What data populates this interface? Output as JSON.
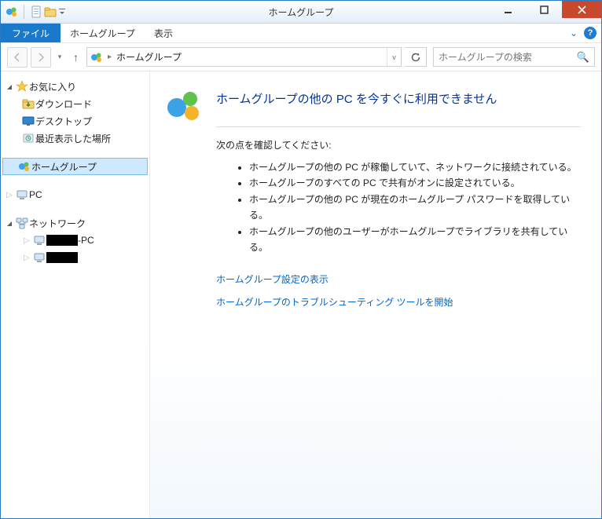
{
  "window": {
    "title": "ホームグループ"
  },
  "menubar": {
    "file": "ファイル",
    "homegroup": "ホームグループ",
    "view": "表示"
  },
  "address": {
    "location": "ホームグループ"
  },
  "search": {
    "placeholder": "ホームグループの検索"
  },
  "sidebar": {
    "favorites": "お気に入り",
    "downloads": "ダウンロード",
    "desktop": "デスクトップ",
    "recent": "最近表示した場所",
    "homegroup": "ホームグループ",
    "pc": "PC",
    "network": "ネットワーク",
    "pc_suffix": "-PC"
  },
  "content": {
    "title": "ホームグループの他の PC を今すぐに利用できません",
    "check_intro": "次の点を確認してください:",
    "bullets": [
      "ホームグループの他の PC が稼働していて、ネットワークに接続されている。",
      "ホームグループのすべての PC で共有がオンに設定されている。",
      "ホームグループの他の PC が現在のホームグループ パスワードを取得している。",
      "ホームグループの他のユーザーがホームグループでライブラリを共有している。"
    ],
    "link_settings": "ホームグループ設定の表示",
    "link_troubleshoot": "ホームグループのトラブルシューティング ツールを開始"
  }
}
